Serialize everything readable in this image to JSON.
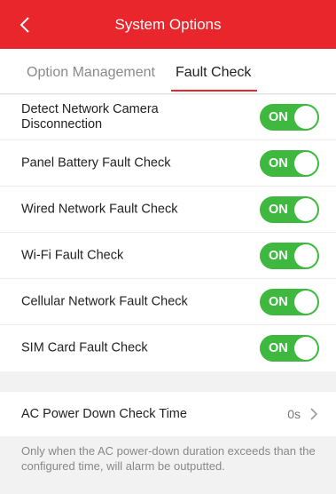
{
  "header": {
    "title": "System Options"
  },
  "tabs": [
    {
      "label": "Option Management",
      "selected": false
    },
    {
      "label": "Fault Check",
      "selected": true
    }
  ],
  "colors": {
    "accent": "#e8262c",
    "toggle_on": "#3fb83f"
  },
  "fault_checks": [
    {
      "label": "Detect Network Camera Disconnection",
      "state": "ON"
    },
    {
      "label": "Panel Battery Fault Check",
      "state": "ON"
    },
    {
      "label": "Wired Network Fault Check",
      "state": "ON"
    },
    {
      "label": "Wi-Fi Fault Check",
      "state": "ON"
    },
    {
      "label": "Cellular Network Fault Check",
      "state": "ON"
    },
    {
      "label": "SIM Card Fault Check",
      "state": "ON"
    }
  ],
  "ac_power": {
    "label": "AC Power Down Check Time",
    "value": "0s"
  },
  "note": "Only when the AC power-down duration exceeds than the configured time, will alarm be outputted."
}
